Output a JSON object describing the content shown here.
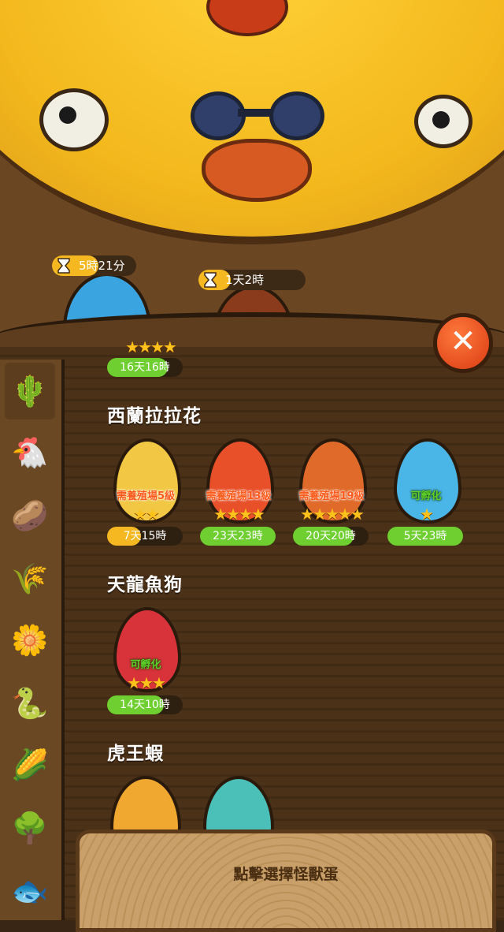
{
  "colors": {
    "gold": "#f6b820",
    "green": "#6fcf30",
    "orange_text": "#ff5a1a"
  },
  "top_eggs": [
    {
      "timer": "5時21分",
      "timer_progress": 0.55,
      "egg_color": "#3aa4e0"
    },
    {
      "timer": "1天2時",
      "timer_progress": 0.3,
      "egg_color": "#8a3b1c"
    }
  ],
  "top_row_partial": {
    "stars": "★★★★",
    "time": "16天16時",
    "progress": 0.8
  },
  "sidebar_icons": [
    "cactus-monster-icon",
    "chicken-monster-icon",
    "scarecrow-monster-icon",
    "wheat-monster-icon",
    "dandelion-monster-icon",
    "snake-monster-icon",
    "corn-monster-icon",
    "tree-monster-icon",
    "fish-monster-icon"
  ],
  "sections": [
    {
      "title": "西蘭拉拉花",
      "eggs": [
        {
          "req": "需養殖場5級",
          "ok": false,
          "stars": "★★",
          "time": "7天15時",
          "progress": 0.45,
          "bar_color": "#f6b820",
          "color": "#f2c744"
        },
        {
          "req": "需養殖場13級",
          "ok": false,
          "stars": "★★★★",
          "time": "23天23時",
          "progress": 1,
          "bar_color": "#6fcf30",
          "color": "#e8502a"
        },
        {
          "req": "需養殖場19級",
          "ok": false,
          "stars": "★★★★★",
          "time": "20天20時",
          "progress": 0.8,
          "bar_color": "#6fcf30",
          "color": "#e06a2a"
        },
        {
          "req": "可孵化",
          "ok": true,
          "stars": "★",
          "time": "5天23時",
          "progress": 1,
          "bar_color": "#6fcf30",
          "color": "#4ab6e8"
        }
      ]
    },
    {
      "title": "天龍魚狗",
      "eggs": [
        {
          "req": "可孵化",
          "ok": true,
          "stars": "★★★",
          "time": "14天10時",
          "progress": 0.75,
          "bar_color": "#6fcf30",
          "color": "#d8333a"
        }
      ]
    },
    {
      "title": "虎王蝦",
      "eggs": [
        {
          "color": "#f0a830"
        },
        {
          "color": "#4ac0b8"
        }
      ]
    }
  ],
  "select_prompt": "點擊選擇怪獸蛋",
  "close_glyph": "✕"
}
